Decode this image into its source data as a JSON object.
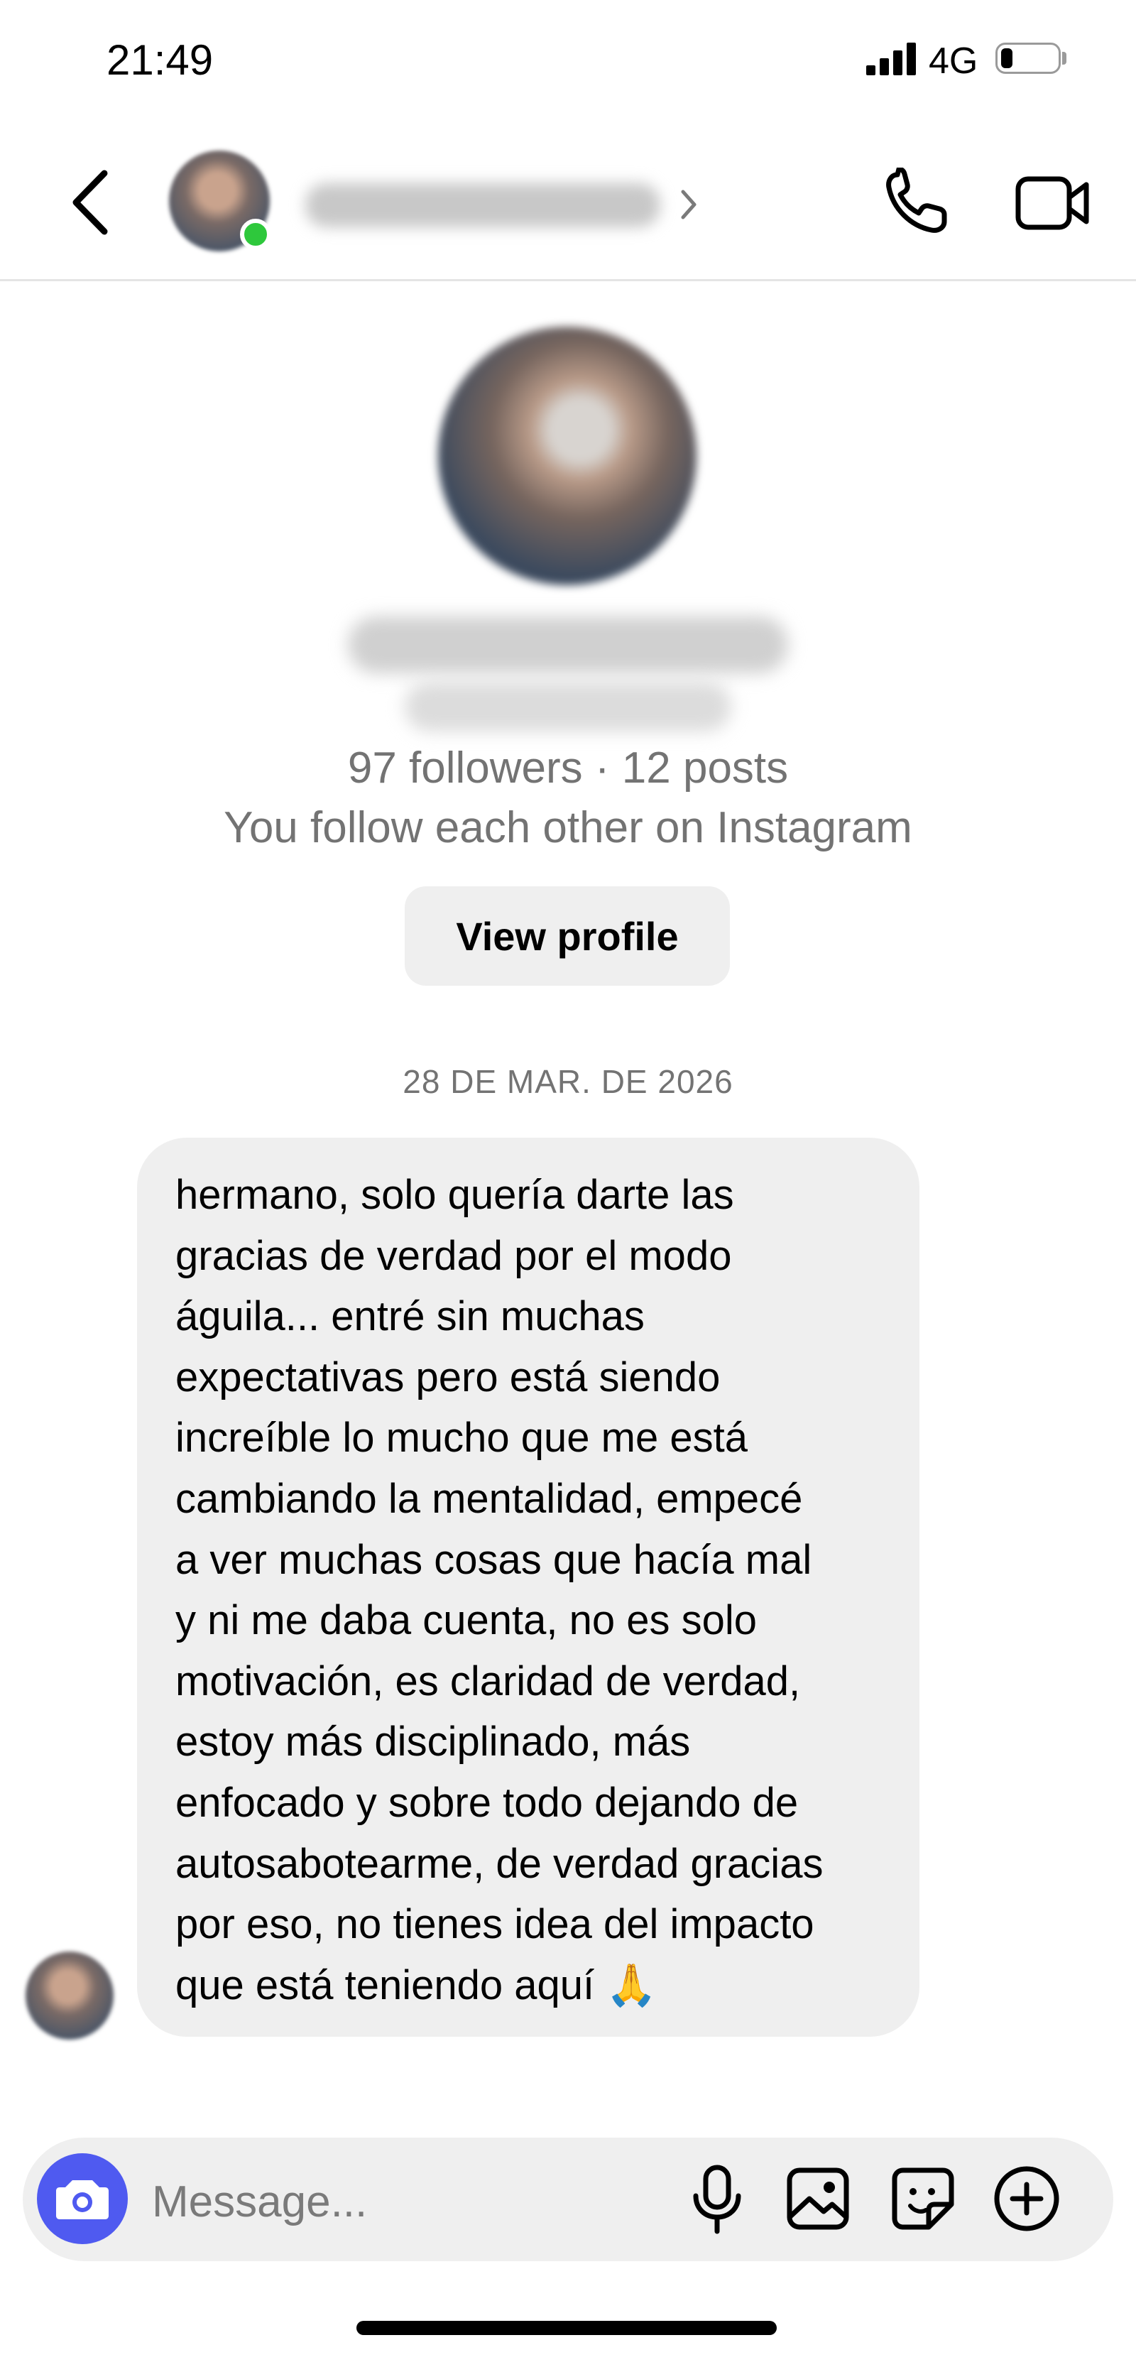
{
  "status_bar": {
    "time": "21:49",
    "network": "4G",
    "battery_level": 0.2
  },
  "header": {
    "back_icon": "chevron-left-icon",
    "contact_status": "online",
    "status_color": "#2ec83c",
    "call_icon": "phone-icon",
    "video_icon": "video-camera-icon"
  },
  "profile": {
    "stats": "97 followers · 12 posts",
    "mutual": "You follow each other on Instagram",
    "view_profile_label": "View profile"
  },
  "conversation": {
    "date_separator": "28 DE MAR. DE 2026",
    "messages": [
      {
        "sender": "contact",
        "text": "hermano, solo quería darte las\ngracias de verdad por el modo\náguila... entré sin muchas\nexpectativas pero está siendo\nincreíble lo mucho que me está\ncambiando la mentalidad, empecé\na ver muchas cosas que hacía mal\ny ni me daba cuenta, no es solo\nmotivación, es claridad de verdad,\nestoy más disciplinado, más\nenfocado y sobre todo dejando de\nautosabotearme, de verdad gracias\npor eso, no tienes idea del impacto\nque está teniendo aquí 🙏"
      }
    ]
  },
  "composer": {
    "placeholder": "Message...",
    "accent_color": "#4f5af0",
    "icons": [
      "camera-icon",
      "microphone-icon",
      "gallery-icon",
      "sticker-icon",
      "plus-circle-icon"
    ]
  }
}
